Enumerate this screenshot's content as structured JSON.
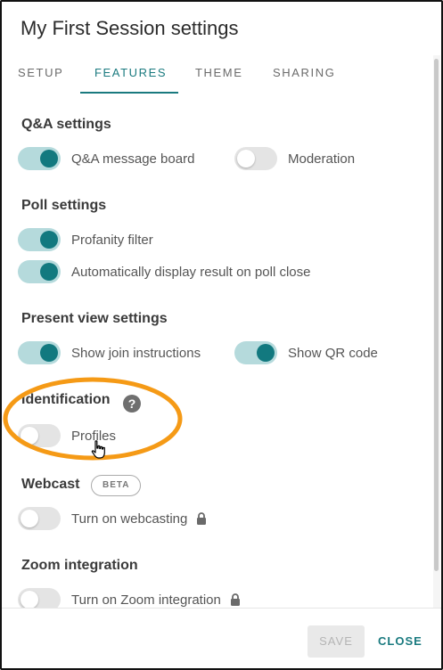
{
  "dialog": {
    "title": "My First Session settings"
  },
  "tabs": [
    {
      "label": "SETUP",
      "active": false
    },
    {
      "label": "FEATURES",
      "active": true
    },
    {
      "label": "THEME",
      "active": false
    },
    {
      "label": "SHARING",
      "active": false
    }
  ],
  "sections": {
    "qa": {
      "title": "Q&A settings",
      "toggles": [
        {
          "label": "Q&A message board",
          "on": true
        },
        {
          "label": "Moderation",
          "on": false
        }
      ]
    },
    "poll": {
      "title": "Poll settings",
      "toggles": [
        {
          "label": "Profanity filter",
          "on": true
        },
        {
          "label": "Automatically display result on poll close",
          "on": true
        }
      ]
    },
    "present": {
      "title": "Present view settings",
      "toggles": [
        {
          "label": "Show join instructions",
          "on": true
        },
        {
          "label": "Show QR code",
          "on": true
        }
      ]
    },
    "identification": {
      "title": "Identification",
      "help_icon": "?",
      "toggles": [
        {
          "label": "Profiles",
          "on": false
        }
      ]
    },
    "webcast": {
      "title": "Webcast",
      "badge": "BETA",
      "toggles": [
        {
          "label": "Turn on webcasting",
          "on": false,
          "locked": true
        }
      ]
    },
    "zoom": {
      "title": "Zoom integration",
      "toggles": [
        {
          "label": "Turn on Zoom integration",
          "on": false,
          "locked": true
        }
      ]
    }
  },
  "footer": {
    "save_label": "SAVE",
    "close_label": "CLOSE"
  },
  "colors": {
    "accent": "#12797f",
    "toggle_on_track": "#b5dadc",
    "highlight": "#f59a16"
  }
}
